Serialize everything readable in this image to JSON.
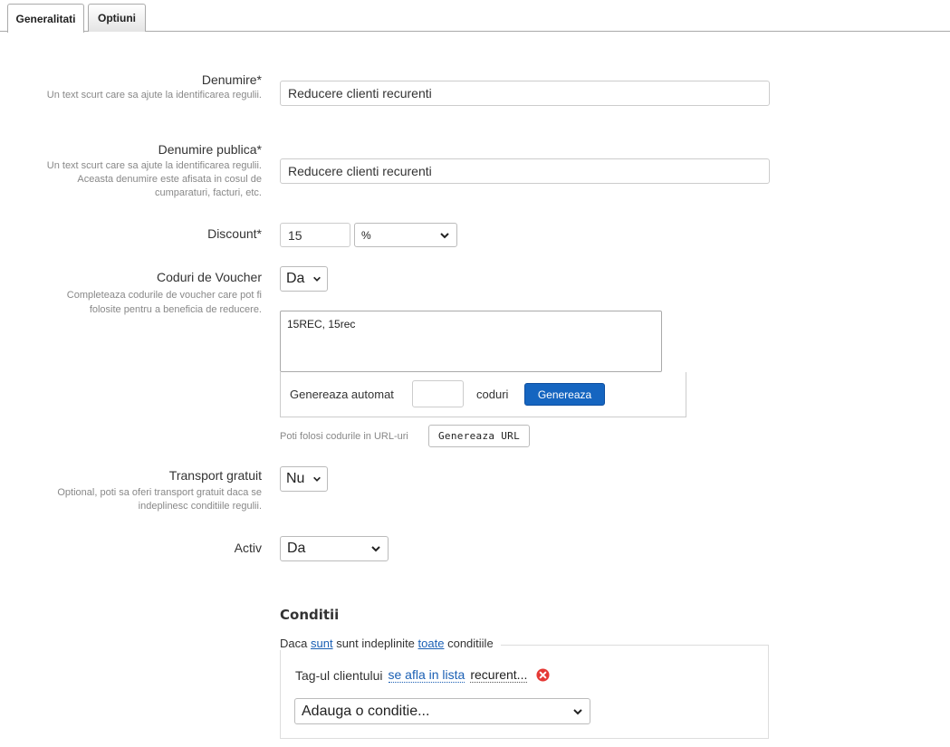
{
  "tabs": [
    {
      "label": "Generalitati",
      "active": true
    },
    {
      "label": "Optiuni",
      "active": false
    }
  ],
  "form": {
    "denumire": {
      "label": "Denumire*",
      "help": "Un text scurt care sa ajute la identificarea regulii.",
      "value": "Reducere clienti recurenti"
    },
    "denumire_publica": {
      "label": "Denumire publica*",
      "help": "Un text scurt care sa ajute la identificarea regulii. Aceasta denumire este afisata in cosul de cumparaturi, facturi, etc.",
      "value": "Reducere clienti recurenti"
    },
    "discount": {
      "label": "Discount*",
      "value": "15",
      "unit": "%"
    },
    "coduri_voucher": {
      "label": "Coduri de Voucher",
      "help": "Completeaza codurile de voucher care pot fi folosite pentru a beneficia de reducere.",
      "select_value": "Da",
      "codes": "15REC, 15rec",
      "generate_prefix": "Genereaza automat",
      "generate_count": "",
      "generate_suffix": "coduri",
      "generate_button": "Genereaza",
      "url_hint": "Poti folosi codurile in URL-uri",
      "url_button": "Genereaza URL"
    },
    "transport_gratuit": {
      "label": "Transport gratuit",
      "help": "Optional, poti sa oferi transport gratuit daca se indeplinesc conditiile regulii.",
      "select_value": "Nu"
    },
    "activ": {
      "label": "Activ",
      "select_value": "Da"
    }
  },
  "conditii": {
    "title": "Conditii",
    "legend": {
      "prefix": "Daca",
      "sunt_link": "sunt",
      "middle": "sunt indeplinite",
      "toate_link": "toate",
      "suffix": "conditiile"
    },
    "rule": {
      "field": "Tag-ul clientului",
      "operator": "se afla in lista",
      "value": "recurent..."
    },
    "add_select": "Adauga o conditie..."
  },
  "colors": {
    "primary": "#1565c0",
    "link": "#1a5fb4",
    "remove": "#e53935"
  }
}
